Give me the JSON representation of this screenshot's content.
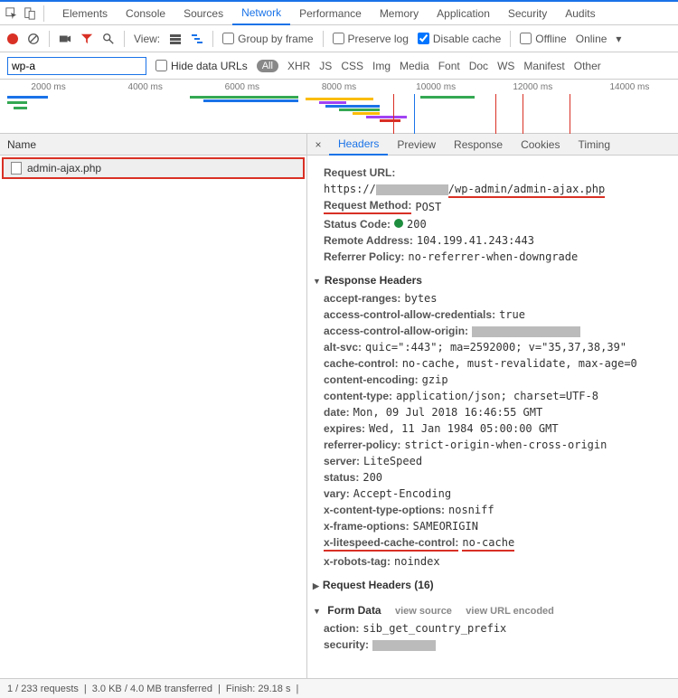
{
  "top_tabs": [
    "Elements",
    "Console",
    "Sources",
    "Network",
    "Performance",
    "Memory",
    "Application",
    "Security",
    "Audits"
  ],
  "top_active": "Network",
  "toolbar": {
    "view_label": "View:",
    "group_by_frame": "Group by frame",
    "preserve_log": "Preserve log",
    "disable_cache": "Disable cache",
    "offline": "Offline",
    "online": "Online"
  },
  "filter": {
    "value": "wp-a",
    "hide_data_urls": "Hide data URLs",
    "all": "All",
    "types": [
      "XHR",
      "JS",
      "CSS",
      "Img",
      "Media",
      "Font",
      "Doc",
      "WS",
      "Manifest",
      "Other"
    ]
  },
  "timeline_ticks": [
    "2000 ms",
    "4000 ms",
    "6000 ms",
    "8000 ms",
    "10000 ms",
    "12000 ms",
    "14000 ms"
  ],
  "name_col": "Name",
  "request_name": "admin-ajax.php",
  "right_tabs": [
    "Headers",
    "Preview",
    "Response",
    "Cookies",
    "Timing"
  ],
  "right_active": "Headers",
  "general": {
    "request_url_k": "Request URL:",
    "request_url_prefix": "https://",
    "request_url_suffix": "/wp-admin/admin-ajax.php",
    "request_method_k": "Request Method:",
    "request_method_v": "POST",
    "status_code_k": "Status Code:",
    "status_code_v": "200",
    "remote_addr_k": "Remote Address:",
    "remote_addr_v": "104.199.41.243:443",
    "referrer_policy_k": "Referrer Policy:",
    "referrer_policy_v": "no-referrer-when-downgrade"
  },
  "resp_head_title": "Response Headers",
  "resp_headers": [
    {
      "k": "accept-ranges:",
      "v": "bytes"
    },
    {
      "k": "access-control-allow-credentials:",
      "v": "true"
    },
    {
      "k": "access-control-allow-origin:",
      "v": "",
      "gray": 120
    },
    {
      "k": "alt-svc:",
      "v": "quic=\":443\"; ma=2592000; v=\"35,37,38,39\""
    },
    {
      "k": "cache-control:",
      "v": "no-cache, must-revalidate, max-age=0"
    },
    {
      "k": "content-encoding:",
      "v": "gzip"
    },
    {
      "k": "content-type:",
      "v": "application/json; charset=UTF-8"
    },
    {
      "k": "date:",
      "v": "Mon, 09 Jul 2018 16:46:55 GMT"
    },
    {
      "k": "expires:",
      "v": "Wed, 11 Jan 1984 05:00:00 GMT"
    },
    {
      "k": "referrer-policy:",
      "v": "strict-origin-when-cross-origin"
    },
    {
      "k": "server:",
      "v": "LiteSpeed"
    },
    {
      "k": "status:",
      "v": "200"
    },
    {
      "k": "vary:",
      "v": "Accept-Encoding"
    },
    {
      "k": "x-content-type-options:",
      "v": "nosniff"
    },
    {
      "k": "x-frame-options:",
      "v": "SAMEORIGIN"
    },
    {
      "k": "x-litespeed-cache-control:",
      "v": "no-cache",
      "under": true
    },
    {
      "k": "x-robots-tag:",
      "v": "noindex"
    }
  ],
  "req_head_title": "Request Headers (16)",
  "form_data_title": "Form Data",
  "view_source": "view source",
  "view_url_encoded": "view URL encoded",
  "form_data": [
    {
      "k": "action:",
      "v": "sib_get_country_prefix"
    },
    {
      "k": "security:",
      "v": "",
      "gray": 70
    }
  ],
  "status": {
    "requests": "1 / 233 requests",
    "transferred": "3.0 KB / 4.0 MB transferred",
    "finish": "Finish: 29.18 s"
  }
}
